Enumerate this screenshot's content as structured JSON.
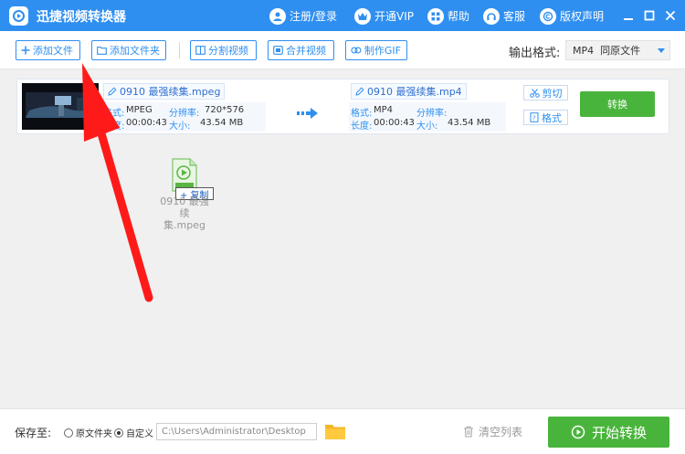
{
  "titlebar": {
    "app_title": "迅捷视频转换器",
    "register_login": "注册/登录",
    "vip": "开通VIP",
    "help": "帮助",
    "service": "客服",
    "copyright": "版权声明"
  },
  "toolbar": {
    "add_file": "添加文件",
    "add_folder": "添加文件夹",
    "split_video": "分割视频",
    "merge_video": "合并视频",
    "make_gif": "制作GIF",
    "output_format_label": "输出格式:",
    "output_format_value": "MP4  同原文件"
  },
  "file": {
    "source_name": "0910 最强续集.mpeg",
    "target_name": "0910 最强续集.mp4",
    "source": {
      "format_label": "格式:",
      "format": "MPEG",
      "resolution_label": "分辨率:",
      "resolution": "720*576",
      "duration_label": "长度:",
      "duration": "00:00:43",
      "size_label": "大小:",
      "size": "43.54 MB"
    },
    "target": {
      "format_label": "格式:",
      "format": "MP4",
      "resolution_label": "分辨率:",
      "resolution": "",
      "duration_label": "长度:",
      "duration": "00:00:43",
      "size_label": "大小:",
      "size": "43.54 MB"
    },
    "cut_button": "剪切",
    "format_button": "格式",
    "convert_button": "转换"
  },
  "drag": {
    "copy_tip": "+ 复制",
    "file_name_line1": "0910 最强续",
    "file_name_line2": "集.mpeg"
  },
  "bottom": {
    "save_to_label": "保存至:",
    "radio_original": "原文件夹",
    "radio_custom": "自定义",
    "selected_option": "自定义",
    "path_value": "C:\\Users\\Administrator\\Desktop",
    "clear_list": "清空列表",
    "start_convert": "开始转换"
  },
  "colors": {
    "brand_blue": "#2f8ff0",
    "convert_green": "#49b43c",
    "annotation_red": "#ff1a1a"
  },
  "icons": [
    "app-logo-icon",
    "user-icon",
    "vip-icon",
    "help-icon",
    "headset-icon",
    "copyright-icon",
    "minimize-icon",
    "maximize-icon",
    "close-icon",
    "plus-icon",
    "folder-add-icon",
    "split-icon",
    "merge-icon",
    "gif-icon",
    "edit-icon",
    "arrow-right-icon",
    "scissors-icon",
    "format-icon",
    "video-file-icon",
    "folder-icon",
    "trash-icon",
    "play-circle-icon"
  ]
}
